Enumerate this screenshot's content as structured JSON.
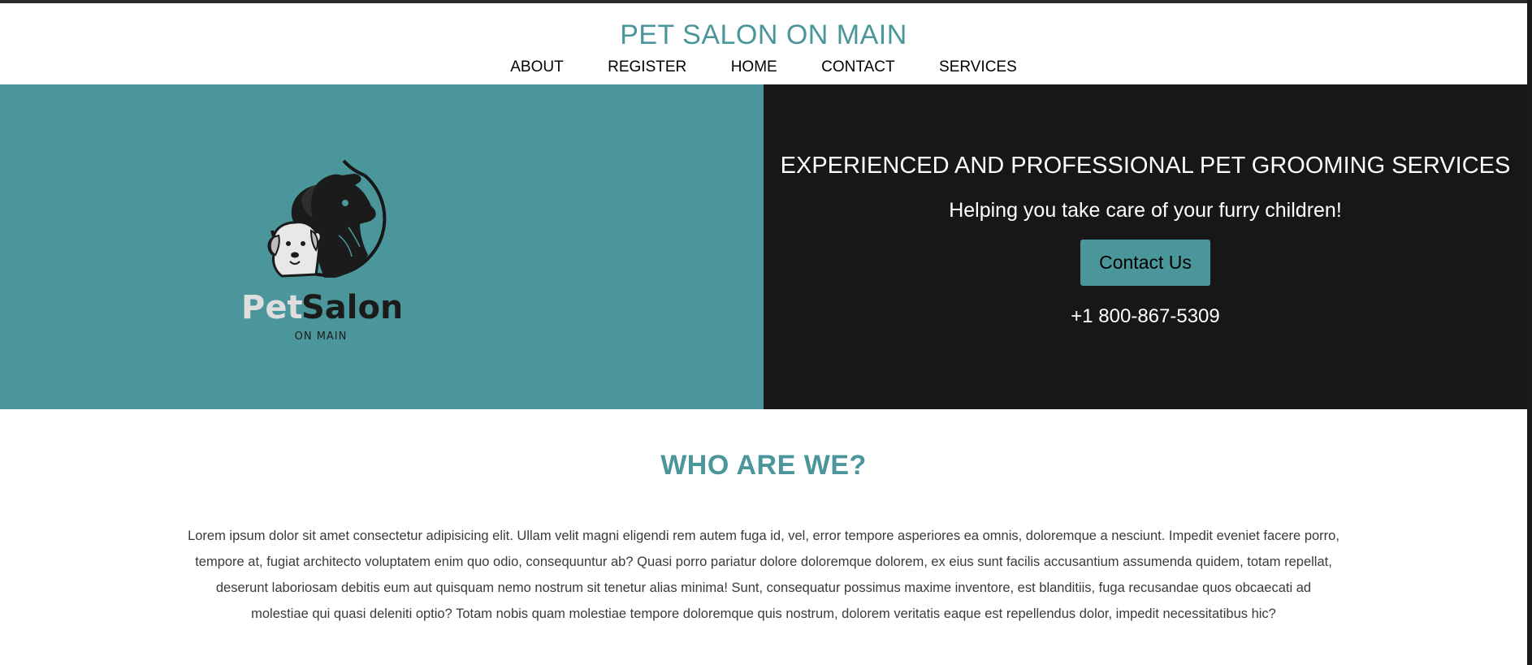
{
  "header": {
    "title": "PET SALON ON MAIN",
    "nav": [
      "ABOUT",
      "REGISTER",
      "HOME",
      "CONTACT",
      "SERVICES"
    ]
  },
  "hero": {
    "logo": {
      "word1": "Pet",
      "word2": "Salon",
      "tagline": "ON MAIN"
    },
    "heading": "EXPERIENCED AND PROFESSIONAL PET GROOMING SERVICES",
    "subheading": "Helping you take care of your furry children!",
    "button_label": "Contact Us",
    "phone": "+1 800-867-5309"
  },
  "about": {
    "title": "WHO ARE WE?",
    "text": "Lorem ipsum dolor sit amet consectetur adipisicing elit. Ullam velit magni eligendi rem autem fuga id, vel, error tempore asperiores ea omnis, doloremque a nesciunt. Impedit eveniet facere porro, tempore at, fugiat architecto voluptatem enim quo odio, consequuntur ab? Quasi porro pariatur dolore doloremque dolorem, ex eius sunt facilis accusantium assumenda quidem, totam repellat, deserunt laboriosam debitis eum aut quisquam nemo nostrum sit tenetur alias minima! Sunt, consequatur possimus maxime inventore, est blanditiis, fuga recusandae quos obcaecati ad molestiae qui quasi deleniti optio? Totam nobis quam molestiae tempore doloremque quis nostrum, dolorem veritatis eaque est repellendus dolor, impedit necessitatibus hic?"
  },
  "colors": {
    "accent": "#4b969a",
    "hero_dark": "#171717",
    "text": "#3a3a3a"
  },
  "icons": {
    "logo": "dog-and-puppy-logo-icon"
  }
}
